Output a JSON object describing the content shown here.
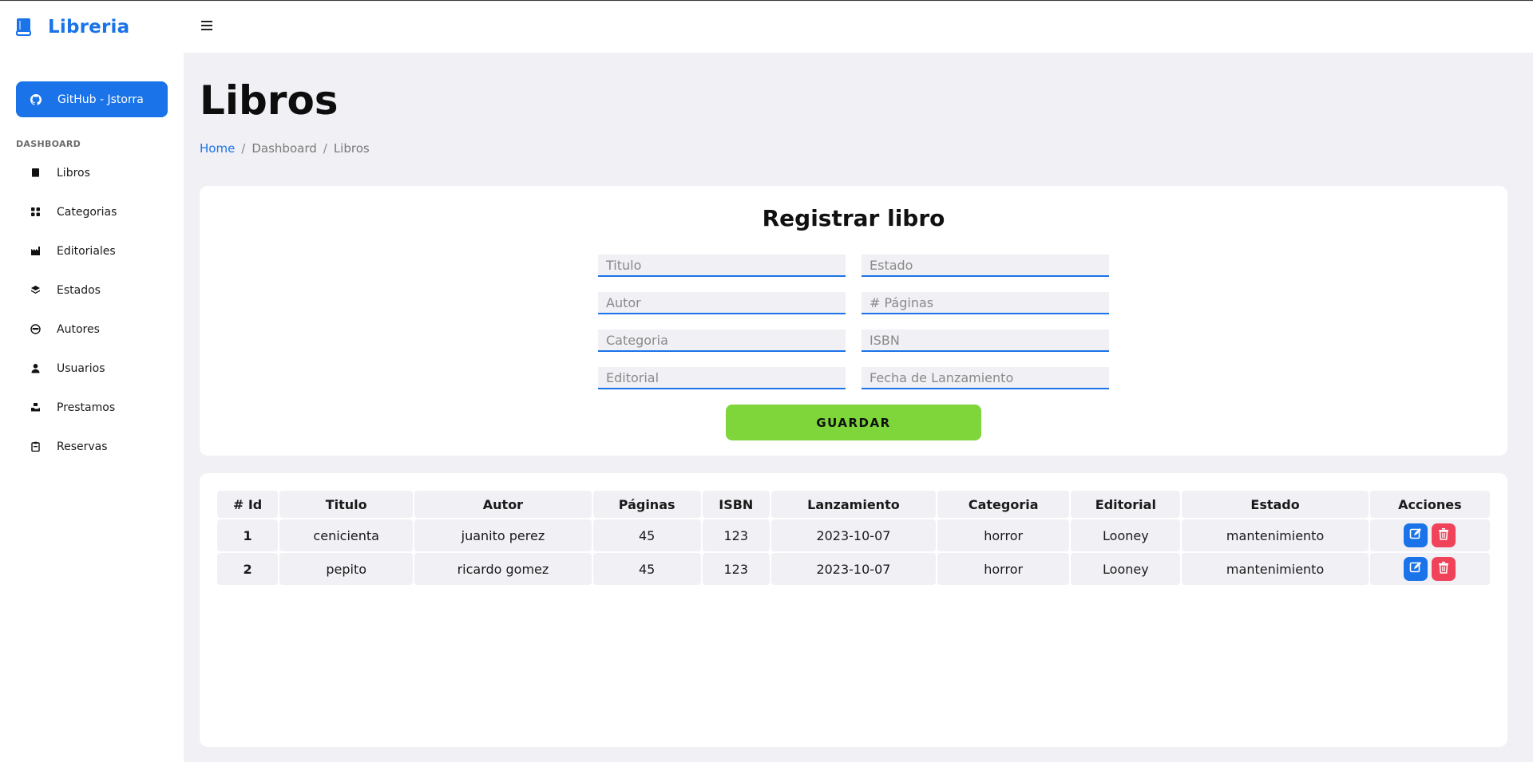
{
  "app": {
    "brand": "Libreria"
  },
  "sidebar": {
    "github_button": "GitHub - Jstorra",
    "section_label": "DASHBOARD",
    "items": [
      {
        "label": "Libros",
        "icon": "book-icon"
      },
      {
        "label": "Categorias",
        "icon": "grid-icon"
      },
      {
        "label": "Editoriales",
        "icon": "industry-icon"
      },
      {
        "label": "Estados",
        "icon": "layers-icon"
      },
      {
        "label": "Autores",
        "icon": "masked-face-icon"
      },
      {
        "label": "Usuarios",
        "icon": "user-icon"
      },
      {
        "label": "Prestamos",
        "icon": "hand-box-icon"
      },
      {
        "label": "Reservas",
        "icon": "clipboard-icon"
      }
    ]
  },
  "header": {
    "title": "Libros",
    "breadcrumb": [
      "Home",
      "Dashboard",
      "Libros"
    ]
  },
  "form": {
    "title": "Registrar libro",
    "fields": {
      "titulo": "Titulo",
      "estado": "Estado",
      "autor": "Autor",
      "paginas": "# Páginas",
      "categoria": "Categoria",
      "isbn": "ISBN",
      "editorial": "Editorial",
      "fecha": "Fecha de Lanzamiento"
    },
    "save_label": "GUARDAR"
  },
  "table": {
    "headers": [
      "# Id",
      "Titulo",
      "Autor",
      "Páginas",
      "ISBN",
      "Lanzamiento",
      "Categoria",
      "Editorial",
      "Estado",
      "Acciones"
    ],
    "rows": [
      [
        "1",
        "cenicienta",
        "juanito perez",
        "45",
        "123",
        "2023-10-07",
        "horror",
        "Looney",
        "mantenimiento"
      ],
      [
        "2",
        "pepito",
        "ricardo gomez",
        "45",
        "123",
        "2023-10-07",
        "horror",
        "Looney",
        "mantenimiento"
      ]
    ]
  },
  "colors": {
    "accent": "#1a73e8",
    "save": "#7ed63a",
    "delete": "#f0435a",
    "background": "#f0f0f5"
  }
}
